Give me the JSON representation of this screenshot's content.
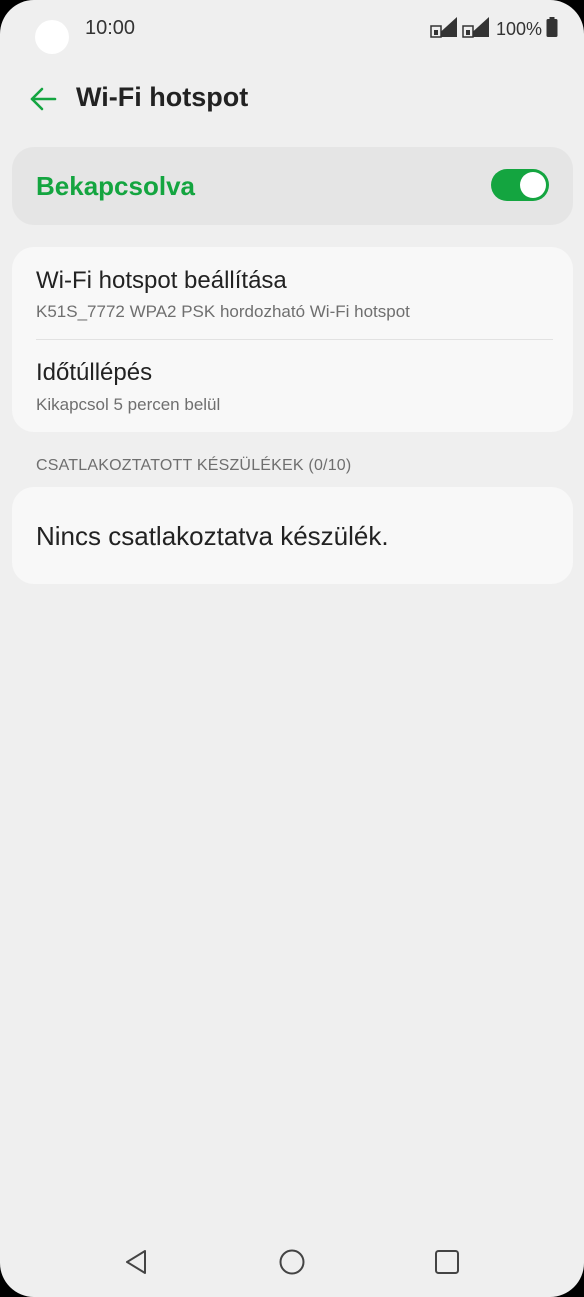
{
  "status_bar": {
    "time": "10:00",
    "battery": "100%"
  },
  "app_bar": {
    "title": "Wi-Fi hotspot",
    "back_icon": "arrow-left-icon"
  },
  "master_switch": {
    "label": "Bekapcsolva",
    "state": "on"
  },
  "settings": [
    {
      "title": "Wi-Fi hotspot beállítása",
      "summary": "K51S_7772 WPA2 PSK hordozható Wi-Fi hotspot"
    },
    {
      "title": "Időtúllépés",
      "summary": "Kikapcsol 5 percen belül"
    }
  ],
  "connected_devices": {
    "header": "CSATLAKOZTATOTT KÉSZÜLÉKEK (0/10)",
    "empty_message": "Nincs csatlakoztatva készülék."
  },
  "colors": {
    "accent": "#14a540",
    "background": "#efefef",
    "card": "#f8f8f8",
    "master_card": "#e5e5e5"
  },
  "nav_bar": {
    "back_icon": "triangle-back-icon",
    "home_icon": "circle-home-icon",
    "recents_icon": "square-recents-icon"
  }
}
